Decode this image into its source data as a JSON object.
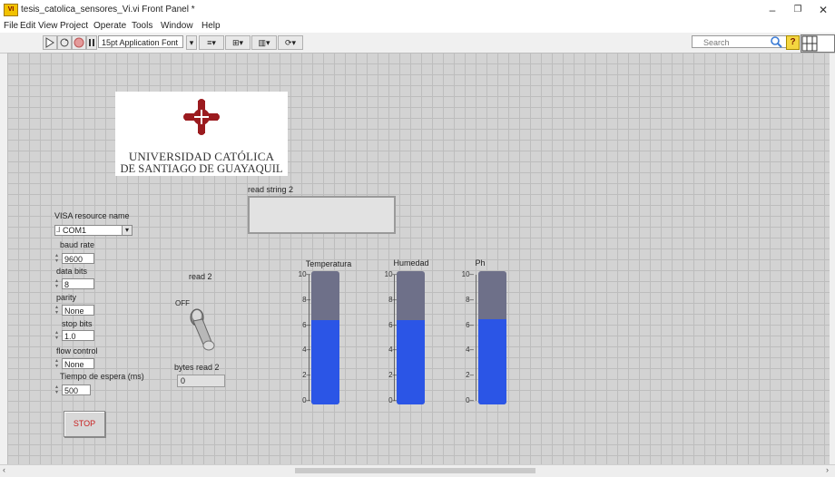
{
  "window": {
    "title": "tesis_catolica_sensores_Vi.vi Front Panel *",
    "app_icon_text": "VI",
    "min_glyph": "–",
    "max_glyph": "❐",
    "close_glyph": "✕"
  },
  "menu": [
    "File",
    "Edit",
    "View",
    "Project",
    "Operate",
    "Tools",
    "Window",
    "Help"
  ],
  "toolbar": {
    "font": "15pt Application Font",
    "search_placeholder": "Search"
  },
  "logo": {
    "line1": "UNIVERSIDAD CATÓLICA",
    "line2": "DE SANTIAGO DE GUAYAQUIL",
    "cross_color": "#9b1b1f"
  },
  "controls": {
    "visa_label": "VISA resource name",
    "visa_value": "COM1",
    "baud_label": "baud rate",
    "baud_value": "9600",
    "databits_label": "data bits",
    "databits_value": "8",
    "parity_label": "parity",
    "parity_value": "None",
    "stopbits_label": "stop bits",
    "stopbits_value": "1.0",
    "flow_label": "flow control",
    "flow_value": "None",
    "timeout_label": "Tiempo de espera (ms)",
    "timeout_value": "500",
    "stop_label": "STOP"
  },
  "indicators": {
    "read_string_label": "read string 2",
    "read_string_value": "",
    "switch_label": "read 2",
    "switch_state": "OFF",
    "bytes_label": "bytes read 2",
    "bytes_value": "0"
  },
  "tanks": [
    {
      "name": "Temperatura",
      "min": 0,
      "max": 10,
      "value": 6.3
    },
    {
      "name": "Humedad",
      "min": 0,
      "max": 10,
      "value": 6.3
    },
    {
      "name": "Ph",
      "min": 0,
      "max": 10,
      "value": 6.4
    }
  ],
  "tick_labels": [
    "10",
    "8",
    "6",
    "4",
    "2",
    "0"
  ],
  "colors": {
    "tank_fill": "#2b55e6",
    "tank_empty": "#6e7089",
    "stop_text": "#c81e1e"
  }
}
